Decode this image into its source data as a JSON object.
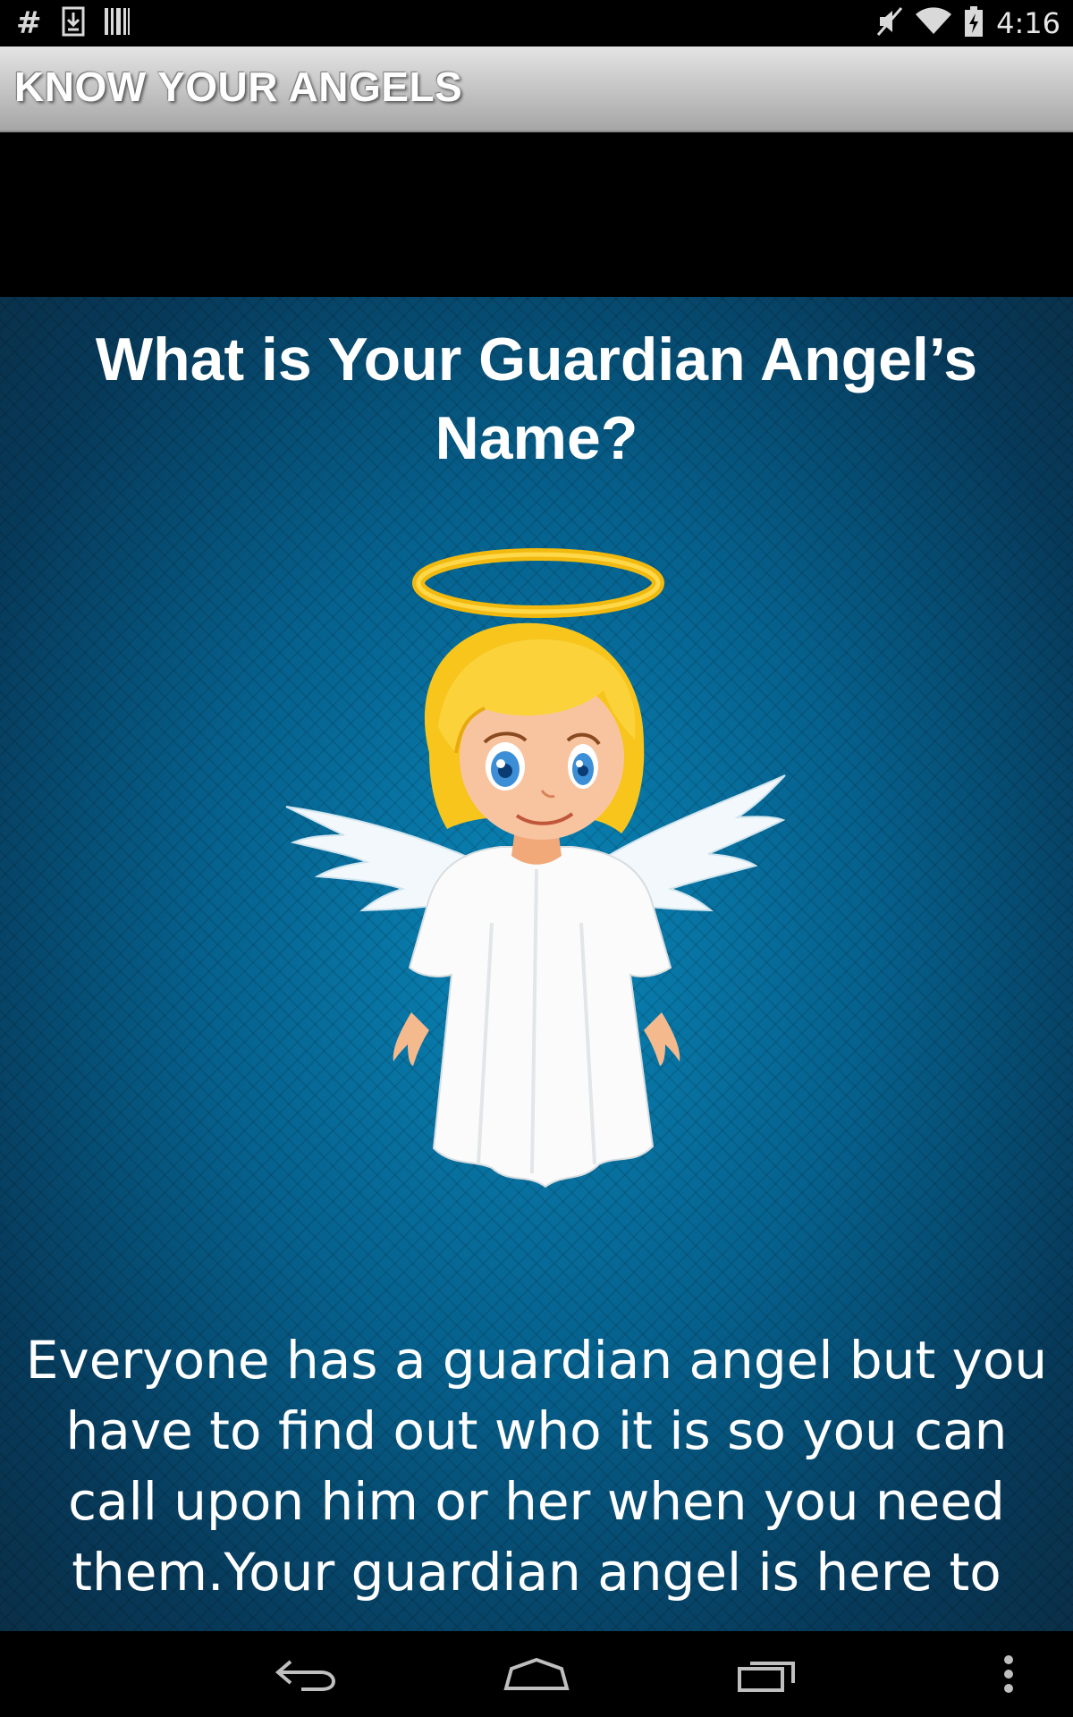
{
  "status_bar": {
    "time": "4:16",
    "left_icons": [
      "hash-icon",
      "download-icon",
      "barcode-icon"
    ],
    "right_icons": [
      "mute-icon",
      "wifi-icon",
      "battery-charging-icon"
    ]
  },
  "action_bar": {
    "title": "KNOW YOUR ANGELS"
  },
  "content": {
    "heading": "What is Your Guardian Angel’s Name?",
    "image": "angel-illustration",
    "body": "Everyone has a guardian angel but you have to find out who it is so you can call upon him or her when you need them.Your guardian angel is here to"
  },
  "nav_bar": {
    "buttons": [
      "back-icon",
      "home-icon",
      "recents-icon",
      "overflow-menu-icon"
    ]
  },
  "colors": {
    "background": "#06608c",
    "halo": "#f5c21b",
    "hair": "#f7c51c",
    "robe": "#ffffff"
  }
}
